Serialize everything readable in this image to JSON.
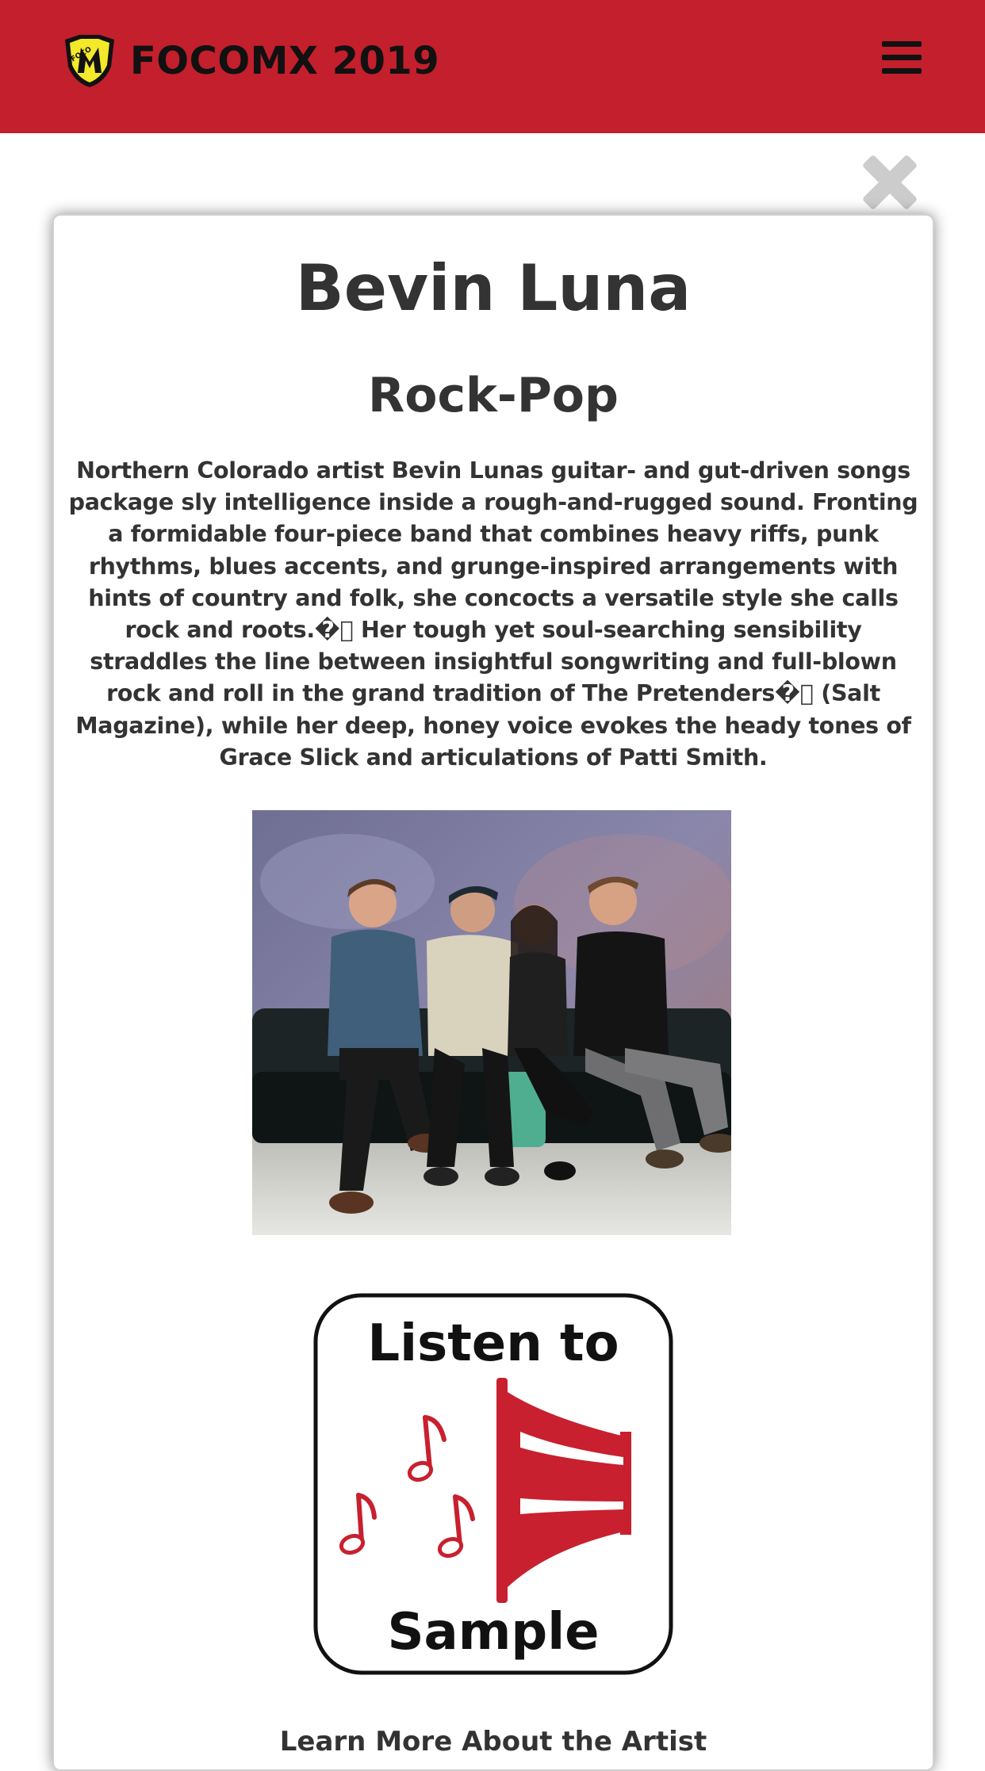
{
  "header": {
    "title": "FOCOMX 2019",
    "background_color": "#c31f2c",
    "logo_icon": "focomx-logo-icon",
    "menu_icon": "hamburger-menu-icon"
  },
  "modal": {
    "close_icon": "close-x-icon",
    "artist_name": "Bevin Luna",
    "genre": "Rock-Pop",
    "bio": "Northern Colorado artist Bevin Lunas guitar- and gut-driven songs package sly intelligence inside a rough-and-rugged sound. Fronting a formidable four-piece band that combines heavy riffs, punk rhythms, blues accents, and grunge-inspired arrangements with hints of country and folk, she concocts a versatile style she calls rock and roots.�⃞ Her tough yet soul-searching sensibility straddles the line between insightful songwriting and full-blown rock and roll in the grand tradition of The Pretenders�⃞ (Salt Magazine), while her deep, honey voice evokes the heady tones of Grace Slick and articulations of Patti Smith.",
    "photo_icon": "band-photo",
    "listen_button": {
      "line1": "Listen to",
      "line2": "Sample",
      "icon": "speaker-horn-music-notes-icon",
      "accent_color": "#c8202f"
    },
    "learn_more": "Learn More About the Artist"
  }
}
